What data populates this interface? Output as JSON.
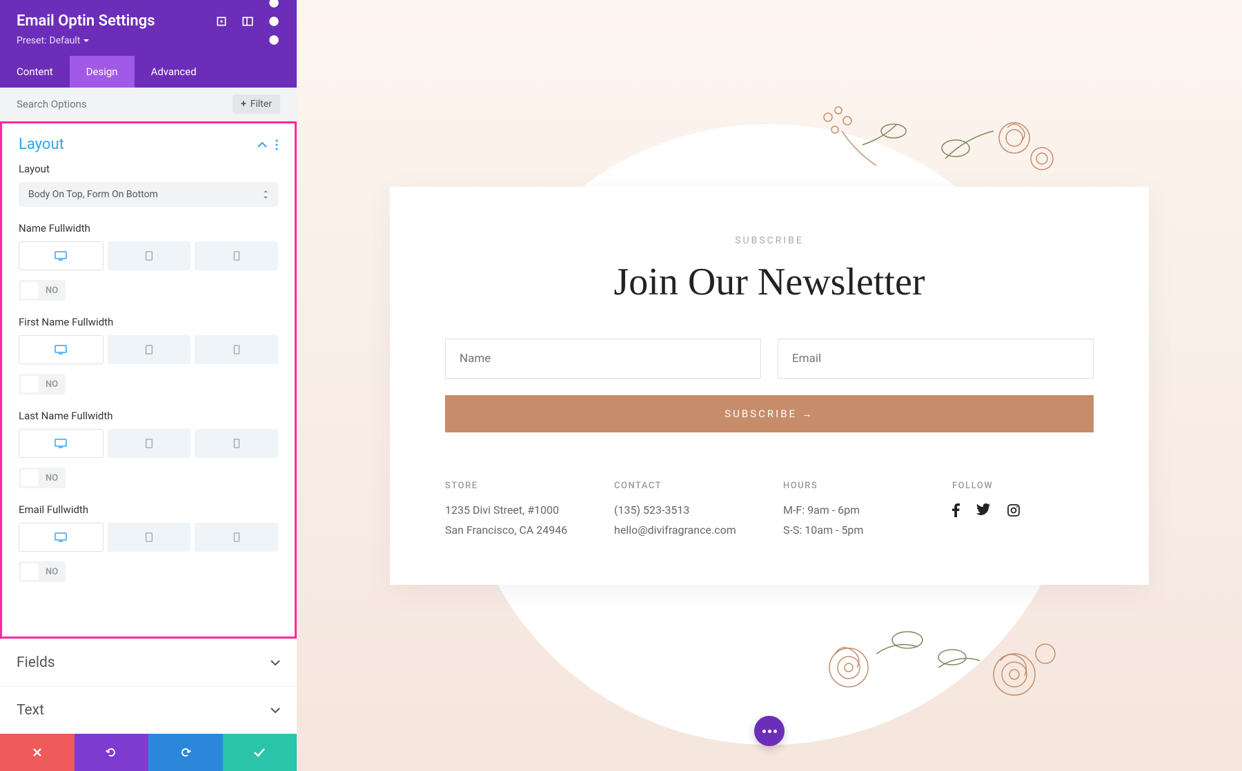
{
  "header": {
    "title": "Email Optin Settings",
    "preset_prefix": "Preset:",
    "preset_value": "Default"
  },
  "tabs": [
    "Content",
    "Design",
    "Advanced"
  ],
  "search": {
    "placeholder": "Search Options",
    "filter_label": "Filter"
  },
  "layout_section": {
    "title": "Layout",
    "layout_label": "Layout",
    "layout_value": "Body On Top, Form On Bottom",
    "fields": [
      {
        "label": "Name Fullwidth",
        "toggle": "NO"
      },
      {
        "label": "First Name Fullwidth",
        "toggle": "NO"
      },
      {
        "label": "Last Name Fullwidth",
        "toggle": "NO"
      },
      {
        "label": "Email Fullwidth",
        "toggle": "NO"
      }
    ]
  },
  "collapsed_sections": [
    "Fields",
    "Text"
  ],
  "preview": {
    "subscribe_label": "SUBSCRIBE",
    "title": "Join Our Newsletter",
    "name_placeholder": "Name",
    "email_placeholder": "Email",
    "button_label": "SUBSCRIBE →",
    "footer": {
      "store": {
        "title": "STORE",
        "line1": "1235 Divi Street, #1000",
        "line2": "San Francisco, CA 24946"
      },
      "contact": {
        "title": "CONTACT",
        "line1": "(135) 523-3513",
        "line2": "hello@divifragrance.com"
      },
      "hours": {
        "title": "HOURS",
        "line1": "M-F: 9am - 6pm",
        "line2": "S-S: 10am - 5pm"
      },
      "follow": {
        "title": "FOLLOW"
      }
    }
  }
}
